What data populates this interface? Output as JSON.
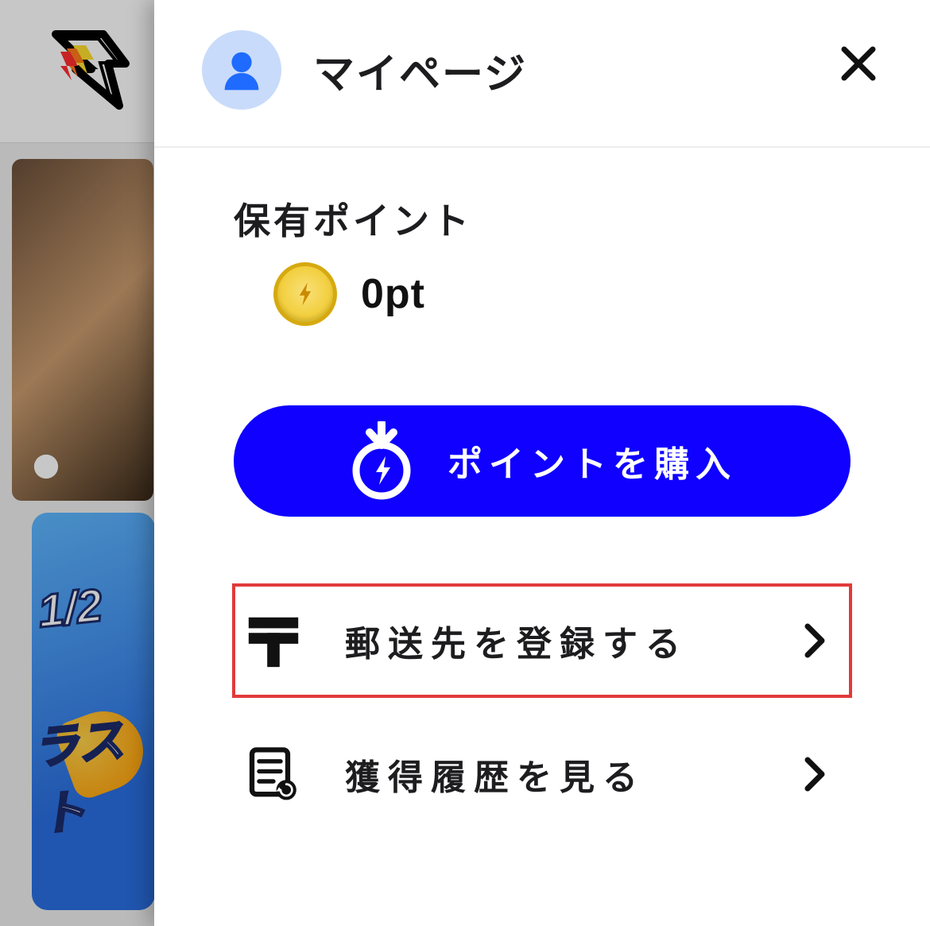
{
  "header": {
    "title": "マイページ"
  },
  "points": {
    "label": "保有ポイント",
    "value": "0pt"
  },
  "actions": {
    "buy_points_label": "ポイントを購入"
  },
  "menu": {
    "items": [
      {
        "label": "郵送先を登録する",
        "highlight": true
      },
      {
        "label": "獲得履歴を見る",
        "highlight": false
      }
    ]
  },
  "background": {
    "card2_text_top": "1/2",
    "card2_text_bottom": "ラスト"
  }
}
